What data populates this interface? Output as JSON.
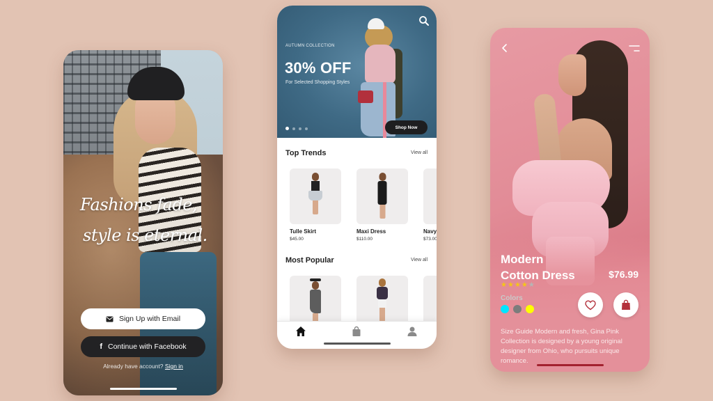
{
  "signup_screen": {
    "quote_line1": "Fashions fade,",
    "quote_line2": "style is eternal.",
    "email_button": {
      "label": "Sign Up with Email",
      "icon": "envelope-icon"
    },
    "facebook_button": {
      "label": "Continue with Facebook",
      "icon": "facebook-icon"
    },
    "signin_prompt": "Already have account?",
    "signin_link": "Sign in"
  },
  "shop_screen": {
    "banner": {
      "kicker": "AUTUMN COLLECTION",
      "headline": "30% OFF",
      "subtitle": "For Selected Shopping Styles",
      "cta_label": "Shop Now",
      "carousel": {
        "total_slides": 4,
        "active_index": 0
      },
      "search_icon": "search-icon"
    },
    "top_trends": {
      "title": "Top Trends",
      "view_all": "View all",
      "items": [
        {
          "name": "Tulle Skirt",
          "price": "$45.00"
        },
        {
          "name": "Maxi Dress",
          "price": "$110.00"
        },
        {
          "name": "Navy",
          "price": "$73.00"
        }
      ]
    },
    "most_popular": {
      "title": "Most Popular",
      "view_all": "View all",
      "items": [
        {
          "name": "",
          "price": ""
        },
        {
          "name": "",
          "price": ""
        },
        {
          "name": "",
          "price": ""
        }
      ]
    },
    "bottom_nav": [
      {
        "icon": "home-icon",
        "active": true
      },
      {
        "icon": "shopping-bag-icon",
        "active": false
      },
      {
        "icon": "user-icon",
        "active": false
      }
    ]
  },
  "detail_screen": {
    "title_line1": "Modern",
    "title_line2": "Cotton Dress",
    "price": "$76.99",
    "rating": {
      "value": 4,
      "max": 5
    },
    "colors_label": "Colors",
    "colors": [
      "#00e5ff",
      "#7c7c7c",
      "#ffff00"
    ],
    "description": "Size Guide Modern and fresh, Gina Pink Collection is designed by a young original designer from Ohio, who pursuits unique romance.",
    "accent_color": "#b3303b"
  },
  "theme": {
    "background": "#e2c3b3",
    "banner_blue": "#3f6a85",
    "detail_pink": "#e28c97",
    "star_color": "#f5c518"
  }
}
